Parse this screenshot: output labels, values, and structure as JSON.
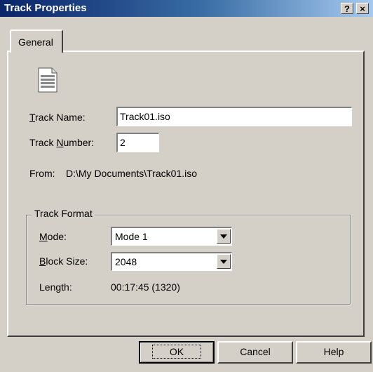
{
  "window": {
    "title": "Track Properties",
    "help_btn": "?",
    "close_btn": "×"
  },
  "tabs": [
    {
      "label": "General"
    }
  ],
  "icon": "document-icon",
  "fields": {
    "track_name": {
      "label_prefix": "",
      "label_underlined": "T",
      "label_rest": "rack Name:",
      "value": "Track01.iso"
    },
    "track_number": {
      "label_prefix": "Track ",
      "label_underlined": "N",
      "label_rest": "umber:",
      "value": "2"
    },
    "from": {
      "label": "From:",
      "value": "D:\\My Documents\\Track01.iso"
    }
  },
  "track_format": {
    "title": "Track Format",
    "mode": {
      "label_underlined": "M",
      "label_rest": "ode:",
      "value": "Mode 1"
    },
    "block_size": {
      "label_underlined": "B",
      "label_rest": "lock Size:",
      "value": "2048"
    },
    "length": {
      "label": "Length:",
      "value": "00:17:45 (1320)"
    }
  },
  "buttons": {
    "ok": "OK",
    "cancel": "Cancel",
    "help": "Help"
  }
}
